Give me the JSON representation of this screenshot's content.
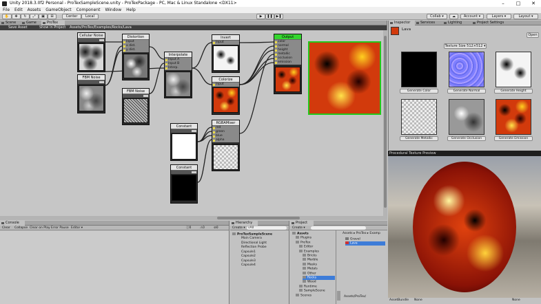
{
  "window": {
    "title": "Unity 2018.3.0f2 Personal - ProTexSampleScene.unity - ProTexPackage - PC, Mac & Linux Standalone <DX11>",
    "minimize": "–",
    "maximize": "□",
    "close": "✕"
  },
  "menu": [
    "File",
    "Edit",
    "Assets",
    "GameObject",
    "Component",
    "Window",
    "Help"
  ],
  "toolbar": {
    "center": "Center",
    "local": "Local",
    "play": "▶",
    "pause": "❚❚",
    "step": "▶❚",
    "collab": "Collab ▾",
    "cloud": "☁",
    "account": "Account ▾",
    "layers": "Layers ▾",
    "layout": "Layout ▾"
  },
  "left_tabs": [
    {
      "label": "Scene"
    },
    {
      "label": "Game"
    },
    {
      "label": "ProTex"
    }
  ],
  "graph_toolbar": {
    "save": "Save Asset",
    "show": "Show in Project",
    "path": "Assets/ProTex/Examples/Rocks/Lava"
  },
  "nodes": {
    "cellular": {
      "title": "Cellular Noise"
    },
    "fbm1": {
      "title": "FBM Noise"
    },
    "distortion": {
      "title": "Distortion",
      "ports": [
        "Input",
        "x dist.",
        "y dist."
      ]
    },
    "fbm2": {
      "title": "FBM Noise"
    },
    "interpolate": {
      "title": "Interpolate",
      "ports": [
        "Input A",
        "Input B",
        "Interp."
      ]
    },
    "invert": {
      "title": "Invert",
      "ports": [
        "Input"
      ]
    },
    "colorize": {
      "title": "Colorize",
      "ports": [
        "Input"
      ]
    },
    "rgbamixer": {
      "title": "RGBAMixer",
      "ports": [
        "red",
        "green",
        "blue",
        "alpha"
      ]
    },
    "constant1": {
      "title": "Constant"
    },
    "constant2": {
      "title": "Constant"
    },
    "output": {
      "title": "Output",
      "ports": [
        "color",
        "normal",
        "height",
        "metallic",
        "occlusion",
        "emission"
      ]
    }
  },
  "console": {
    "tab": "Console",
    "buttons": [
      "Clear",
      "Collapse",
      "Clear on Play",
      "Error Pause",
      "Editor ▾"
    ]
  },
  "hierarchy": {
    "tab": "Hierarchy",
    "create": "Create ▾",
    "search": "⌕All",
    "scene": "ProTexSampleScene",
    "items": [
      "Main Camera",
      "Directional Light",
      "Reflection Probe",
      "Capsule1",
      "Capsule2",
      "Capsule3",
      "Capsule4"
    ]
  },
  "project": {
    "tab": "Project",
    "create": "Create ▾",
    "tree": [
      {
        "label": "Assets",
        "indent": 0,
        "bold": true
      },
      {
        "label": "Plugins",
        "indent": 1
      },
      {
        "label": "ProTex",
        "indent": 1
      },
      {
        "label": "Editor",
        "indent": 2
      },
      {
        "label": "Examples",
        "indent": 2
      },
      {
        "label": "Bricks",
        "indent": 3
      },
      {
        "label": "Marble",
        "indent": 3
      },
      {
        "label": "Masks",
        "indent": 3
      },
      {
        "label": "Metals",
        "indent": 3
      },
      {
        "label": "Other",
        "indent": 3
      },
      {
        "label": "Rocks",
        "indent": 3,
        "selected": true
      },
      {
        "label": "Wood",
        "indent": 3
      },
      {
        "label": "Runtime",
        "indent": 2
      },
      {
        "label": "SampleScene",
        "indent": 2
      },
      {
        "label": "Scenes",
        "indent": 1
      }
    ],
    "breadcrumb": "Assets ▸ ProTex ▸ Examp",
    "files": [
      {
        "label": "Gravel"
      },
      {
        "label": "Lava",
        "selected": true
      }
    ],
    "footer": "Assets/ProTex/"
  },
  "inspector": {
    "tabs": [
      "Inspector",
      "Services",
      "Lighting",
      "Project Settings"
    ],
    "asset_name": "Lava",
    "open": "Open",
    "size": "Texture Size 512×512 ▾",
    "gen": [
      "Generate Color",
      "Generate Normal",
      "Generate Height",
      "Generate Metallic",
      "Generate Occlusion",
      "Generate Emission"
    ]
  },
  "preview": {
    "title": "Procedural Texture Preview"
  },
  "assetbundle": {
    "label": "AssetBundle",
    "value": "None",
    "variant": "None"
  },
  "colors": {
    "output_header": "#35d62f",
    "preview_border": "#22c81a",
    "selection": "#3d7cd8"
  }
}
